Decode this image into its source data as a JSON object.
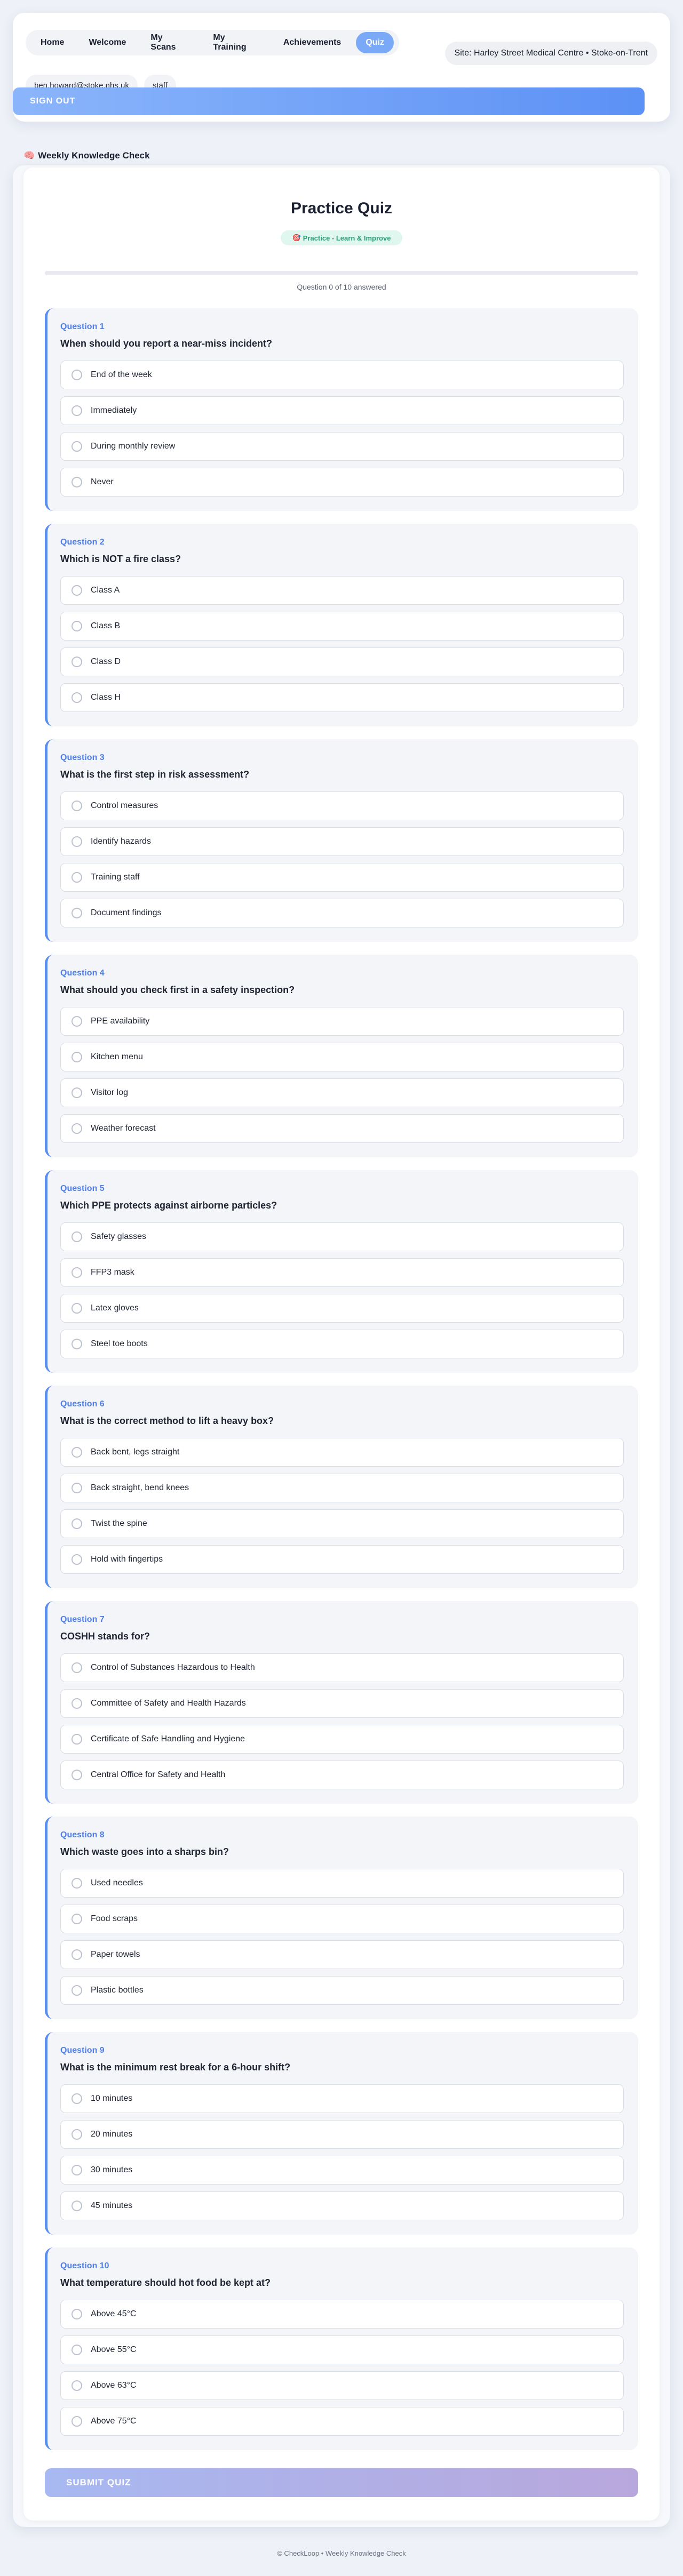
{
  "nav": {
    "tabs": [
      {
        "label": "Home",
        "active": false
      },
      {
        "label": "Welcome",
        "active": false
      },
      {
        "label": "My Scans",
        "active": false
      },
      {
        "label": "My Training",
        "active": false
      },
      {
        "label": "Achievements",
        "active": false
      },
      {
        "label": "Quiz",
        "active": true
      }
    ],
    "site": "Site: Harley Street Medical Centre • Stoke-on-Trent"
  },
  "user": {
    "email": "ben.howard@stoke.nhs.uk",
    "role": "staff"
  },
  "signout_label": "SIGN OUT",
  "section": {
    "icon": "brain-icon",
    "icon_glyph": "🧠",
    "title": "Weekly Knowledge Check"
  },
  "quiz": {
    "title": "Practice Quiz",
    "mode_icon": "target-icon",
    "mode_icon_glyph": "🎯",
    "mode_label": "Practice - Learn & Improve",
    "answered": 0,
    "total": 10,
    "progress_text": "Question 0 of 10 answered",
    "questions": [
      {
        "number": "Question 1",
        "text": "When should you report a near-miss incident?",
        "options": [
          "End of the week",
          "Immediately",
          "During monthly review",
          "Never"
        ]
      },
      {
        "number": "Question 2",
        "text": "Which is NOT a fire class?",
        "options": [
          "Class A",
          "Class B",
          "Class D",
          "Class H"
        ]
      },
      {
        "number": "Question 3",
        "text": "What is the first step in risk assessment?",
        "options": [
          "Control measures",
          "Identify hazards",
          "Training staff",
          "Document findings"
        ]
      },
      {
        "number": "Question 4",
        "text": "What should you check first in a safety inspection?",
        "options": [
          "PPE availability",
          "Kitchen menu",
          "Visitor log",
          "Weather forecast"
        ]
      },
      {
        "number": "Question 5",
        "text": "Which PPE protects against airborne particles?",
        "options": [
          "Safety glasses",
          "FFP3 mask",
          "Latex gloves",
          "Steel toe boots"
        ]
      },
      {
        "number": "Question 6",
        "text": "What is the correct method to lift a heavy box?",
        "options": [
          "Back bent, legs straight",
          "Back straight, bend knees",
          "Twist the spine",
          "Hold with fingertips"
        ]
      },
      {
        "number": "Question 7",
        "text": "COSHH stands for?",
        "options": [
          "Control of Substances Hazardous to Health",
          "Committee of Safety and Health Hazards",
          "Certificate of Safe Handling and Hygiene",
          "Central Office for Safety and Health"
        ]
      },
      {
        "number": "Question 8",
        "text": "Which waste goes into a sharps bin?",
        "options": [
          "Used needles",
          "Food scraps",
          "Paper towels",
          "Plastic bottles"
        ]
      },
      {
        "number": "Question 9",
        "text": "What is the minimum rest break for a 6-hour shift?",
        "options": [
          "10 minutes",
          "20 minutes",
          "30 minutes",
          "45 minutes"
        ]
      },
      {
        "number": "Question 10",
        "text": "What temperature should hot food be kept at?",
        "options": [
          "Above 45°C",
          "Above 55°C",
          "Above 63°C",
          "Above 75°C"
        ]
      }
    ],
    "submit_label": "SUBMIT QUIZ"
  },
  "footer": "© CheckLoop • Weekly Knowledge Check"
}
